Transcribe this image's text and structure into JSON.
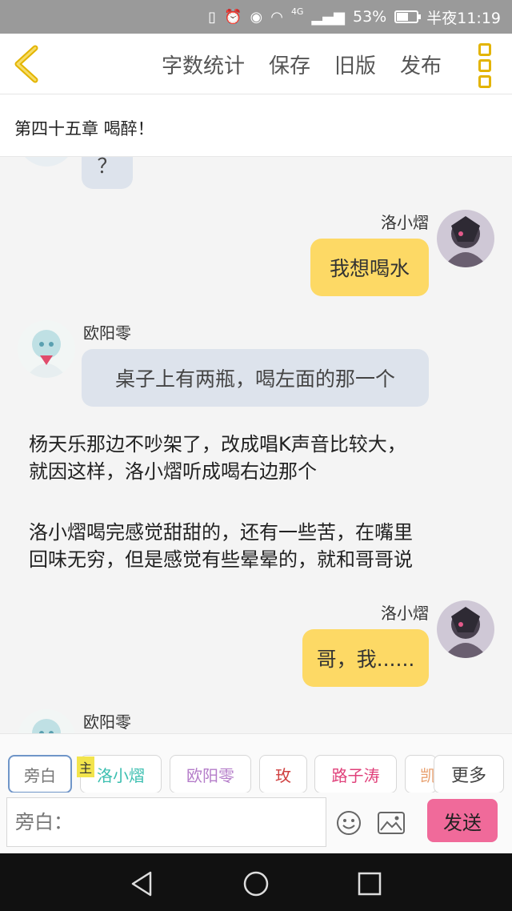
{
  "status_bar": {
    "network": "4G",
    "battery_percent": "53%",
    "battery_level": 0.53,
    "time": "半夜11:19"
  },
  "toolbar": {
    "word_count": "字数统计",
    "save": "保存",
    "old_version": "旧版",
    "publish": "发布"
  },
  "chapter_title": "第四十五章 喝醉！",
  "chat": {
    "partial_bubble": "？",
    "messages": [
      {
        "speaker": "洛小熠",
        "text": "我想喝水"
      },
      {
        "speaker": "欧阳零",
        "text": "桌子上有两瓶，喝左面的那一个"
      },
      {
        "speaker": "洛小熠",
        "text": "哥，我......"
      },
      {
        "speaker": "欧阳零"
      }
    ],
    "narration": [
      [
        "杨天乐那边不吵架了，改成唱K声音比较大，",
        "就因这样，洛小熠听成喝右边那个"
      ],
      [
        "洛小熠喝完感觉甜甜的，还有一些苦，在嘴里",
        "回味无穷，但是感觉有些晕晕的，就和哥哥说"
      ]
    ]
  },
  "roles": {
    "narrator": "旁白",
    "main_tag": "主",
    "items": [
      {
        "label": "洛小熠",
        "color": "#3bbfb0"
      },
      {
        "label": "欧阳零",
        "color": "#b47cc9"
      },
      {
        "label": "玫",
        "color": "#d04040"
      },
      {
        "label": "路子涛",
        "color": "#e0407a"
      },
      {
        "label": "凯",
        "color": "#e8a070"
      }
    ],
    "more": "更多"
  },
  "composer": {
    "placeholder": "旁白：",
    "send": "发送"
  },
  "colors": {
    "accent_yellow": "#e3b400",
    "bubble_self": "#fdd965",
    "bubble_other": "#dde3ec",
    "send_button": "#f06a9a"
  }
}
